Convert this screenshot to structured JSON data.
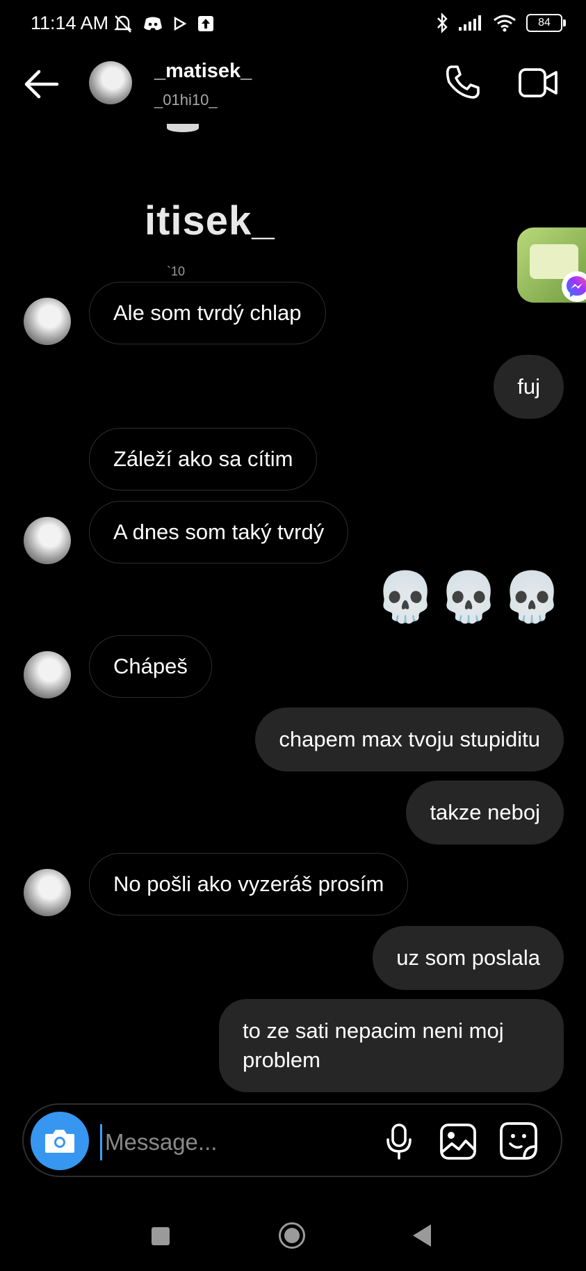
{
  "status_bar": {
    "time": "11:14 AM",
    "battery": "84",
    "icons": [
      "bell-off-icon",
      "discord-icon",
      "play-icon",
      "upload-icon",
      "bluetooth-icon",
      "signal-icon",
      "wifi-icon",
      "battery-icon"
    ]
  },
  "header": {
    "name": "_matisek_",
    "username": "_01hi10_",
    "icons": [
      "back-arrow-icon",
      "phone-icon",
      "video-camera-icon"
    ]
  },
  "profile_fragment": {
    "name_partial": "itisek_",
    "sub_partial": "`10"
  },
  "messages": [
    {
      "from": "them",
      "text": "Ale som tvrdý chlap",
      "avatar": true
    },
    {
      "from": "me",
      "text": "fuj"
    },
    {
      "from": "them",
      "text": "Záleží ako sa cítim",
      "avatar": false
    },
    {
      "from": "them",
      "text": "A dnes som taký tvrdý",
      "avatar": true
    },
    {
      "from": "me",
      "text": "💀💀💀"
    },
    {
      "from": "them",
      "text": "Chápeš",
      "avatar": true
    },
    {
      "from": "me",
      "text": "chapem max tvoju stupiditu"
    },
    {
      "from": "me",
      "text": "takze neboj"
    },
    {
      "from": "them",
      "text": "No pošli ako vyzeráš prosím",
      "avatar": true
    },
    {
      "from": "me",
      "text": "uz som poslala"
    },
    {
      "from": "me",
      "text": "to ze sati nepacim neni moj problem"
    }
  ],
  "composer": {
    "placeholder": "Message...",
    "icons": [
      "camera-icon",
      "microphone-icon",
      "gallery-icon",
      "sticker-icon"
    ]
  },
  "colors": {
    "background": "#000000",
    "outgoing_bubble": "#262626",
    "incoming_border": "#2e2e2e",
    "accent": "#3797f0"
  }
}
